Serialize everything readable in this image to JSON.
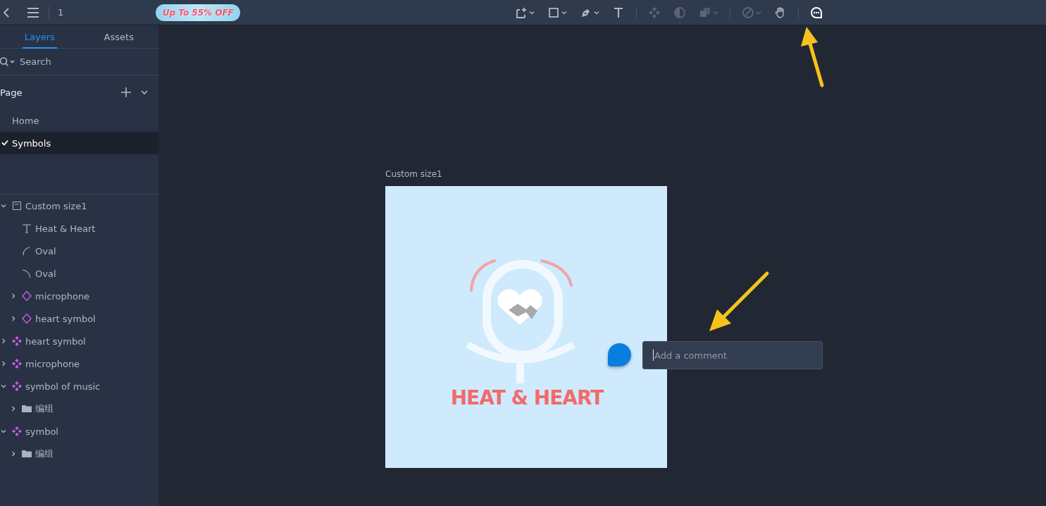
{
  "topbar": {
    "page_number": "1",
    "promo": "Up To 55% OFF"
  },
  "toolbar": {
    "tools": [
      {
        "kind": "frame",
        "caret": true,
        "disabled": false,
        "selected": false
      },
      {
        "kind": "rectangle",
        "caret": true,
        "disabled": false,
        "selected": false
      },
      {
        "kind": "pen",
        "caret": true,
        "disabled": false,
        "selected": false
      },
      {
        "kind": "text",
        "caret": false,
        "disabled": false,
        "selected": false
      },
      {
        "kind": "separator"
      },
      {
        "kind": "component",
        "caret": false,
        "disabled": true,
        "selected": false
      },
      {
        "kind": "mask",
        "caret": false,
        "disabled": true,
        "selected": false
      },
      {
        "kind": "boolean",
        "caret": true,
        "disabled": true,
        "selected": false
      },
      {
        "kind": "separator"
      },
      {
        "kind": "slice",
        "caret": true,
        "disabled": true,
        "selected": false
      },
      {
        "kind": "hand",
        "caret": false,
        "disabled": false,
        "selected": false
      },
      {
        "kind": "separator"
      },
      {
        "kind": "comment",
        "caret": false,
        "disabled": false,
        "selected": true
      }
    ]
  },
  "sidebar": {
    "tabs": [
      {
        "label": "Layers",
        "selected": true
      },
      {
        "label": "Assets",
        "selected": false
      }
    ],
    "search": {
      "placeholder": "Search"
    },
    "pages_title": "Page",
    "pages": [
      {
        "label": "Home",
        "selected": false
      },
      {
        "label": "Symbols",
        "selected": true
      }
    ],
    "layers": [
      {
        "name": "Custom size1",
        "kind": "artboard",
        "expanded": true,
        "children": [
          {
            "name": "Heat & Heart",
            "kind": "text"
          },
          {
            "name": "Oval",
            "kind": "arc-left"
          },
          {
            "name": "Oval",
            "kind": "arc-right"
          },
          {
            "name": "microphone",
            "kind": "instance",
            "expanded": false
          },
          {
            "name": "heart symbol",
            "kind": "instance",
            "expanded": false
          }
        ]
      },
      {
        "name": "heart symbol",
        "kind": "component",
        "expanded": false
      },
      {
        "name": "microphone",
        "kind": "component",
        "expanded": false
      },
      {
        "name": "symbol of music",
        "kind": "component",
        "expanded": true,
        "children": [
          {
            "name": "编组",
            "kind": "group",
            "expanded": false
          }
        ]
      },
      {
        "name": "symbol",
        "kind": "component",
        "expanded": true,
        "children": [
          {
            "name": "编组",
            "kind": "group",
            "expanded": false
          }
        ]
      }
    ]
  },
  "canvas": {
    "artboard_label": "Custom size1",
    "logo_text": "HEAT & HEART",
    "comment": {
      "placeholder": "Add a comment"
    }
  }
}
